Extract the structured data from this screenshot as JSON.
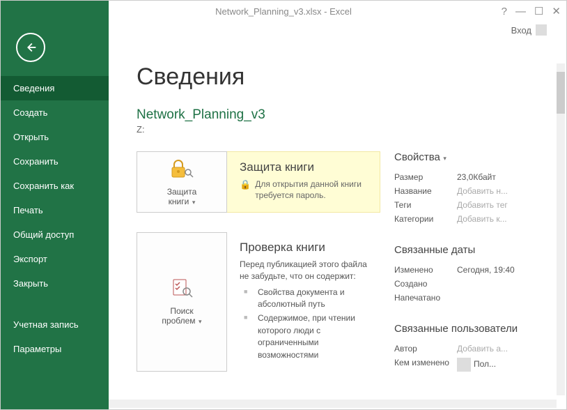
{
  "titlebar": {
    "text": "Network_Planning_v3.xlsx - Excel"
  },
  "signin": {
    "label": "Вход"
  },
  "sidebar": {
    "activeIndex": 0,
    "items": [
      {
        "label": "Сведения"
      },
      {
        "label": "Создать"
      },
      {
        "label": "Открыть"
      },
      {
        "label": "Сохранить"
      },
      {
        "label": "Сохранить как"
      },
      {
        "label": "Печать"
      },
      {
        "label": "Общий доступ"
      },
      {
        "label": "Экспорт"
      },
      {
        "label": "Закрыть"
      }
    ],
    "footer": [
      {
        "label": "Учетная запись"
      },
      {
        "label": "Параметры"
      }
    ]
  },
  "page": {
    "title": "Сведения",
    "docName": "Network_Planning_v3",
    "docPath": "Z:"
  },
  "protect": {
    "btnLine1": "Защита",
    "btnLine2": "книги",
    "header": "Защита книги",
    "note": "Для открытия данной книги требуется пароль."
  },
  "inspect": {
    "btnLine1": "Поиск",
    "btnLine2": "проблем",
    "header": "Проверка книги",
    "desc": "Перед публикацией этого файла не забудьте, что он содержит:",
    "items": [
      "Свойства документа и абсолютный путь",
      "Содержимое, при чтении которого люди с ограниченными возможностями"
    ]
  },
  "props": {
    "header": "Свойства",
    "rows": [
      {
        "label": "Размер",
        "value": "23,0Кбайт",
        "placeholder": false
      },
      {
        "label": "Название",
        "value": "Добавить н...",
        "placeholder": true
      },
      {
        "label": "Теги",
        "value": "Добавить тег",
        "placeholder": true
      },
      {
        "label": "Категории",
        "value": "Добавить к...",
        "placeholder": true
      }
    ]
  },
  "dates": {
    "header": "Связанные даты",
    "rows": [
      {
        "label": "Изменено",
        "value": "Сегодня, 19:40"
      },
      {
        "label": "Создано",
        "value": ""
      },
      {
        "label": "Напечатано",
        "value": ""
      }
    ]
  },
  "people": {
    "header": "Связанные пользователи",
    "rows": [
      {
        "label": "Автор",
        "value": "Добавить а...",
        "placeholder": true
      },
      {
        "label": "Кем изменено",
        "value": "Пол...",
        "placeholder": false,
        "avatar": true
      }
    ]
  }
}
